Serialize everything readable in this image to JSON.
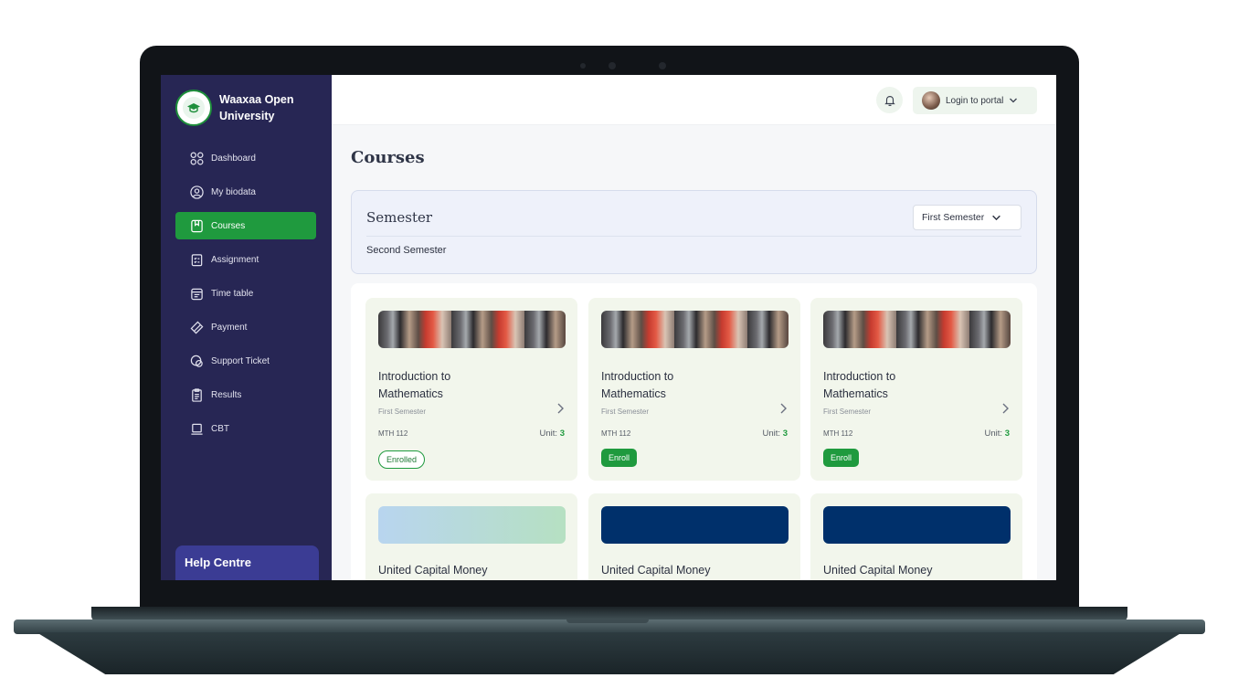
{
  "brand": {
    "name": "Waaxaa Open University",
    "logo_text": "WaaXaa"
  },
  "sidebar": {
    "items": [
      {
        "label": "Dashboard",
        "icon": "grid-icon"
      },
      {
        "label": "My biodata",
        "icon": "user-circle-icon"
      },
      {
        "label": "Courses",
        "icon": "book-icon",
        "active": true
      },
      {
        "label": "Assignment",
        "icon": "clipboard-icon"
      },
      {
        "label": "Time table",
        "icon": "calendar-icon"
      },
      {
        "label": "Payment",
        "icon": "tag-icon"
      },
      {
        "label": "Support Ticket",
        "icon": "chat-icon"
      },
      {
        "label": "Results",
        "icon": "document-icon"
      },
      {
        "label": "CBT",
        "icon": "laptop-icon"
      }
    ],
    "help_title": "Help Centre"
  },
  "topbar": {
    "login_label": "Login to portal"
  },
  "main": {
    "title": "Courses",
    "semester": {
      "title": "Semester",
      "selected": "First Semester",
      "option": "Second Semester"
    },
    "courses": [
      {
        "title": "Introduction to Mathematics",
        "semester": "First Semester",
        "code": "MTH 112",
        "unit_label": "Unit:",
        "unit": "3",
        "action": "Enrolled"
      },
      {
        "title": "Introduction to Mathematics",
        "semester": "First Semester",
        "code": "MTH 112",
        "unit_label": "Unit:",
        "unit": "3",
        "action": "Enroll"
      },
      {
        "title": "Introduction to Mathematics",
        "semester": "First Semester",
        "code": "MTH 112",
        "unit_label": "Unit:",
        "unit": "3",
        "action": "Enroll"
      }
    ],
    "courses_row2": [
      {
        "title": "United Capital Money"
      },
      {
        "title": "United Capital Money"
      },
      {
        "title": "United Capital Money"
      }
    ]
  },
  "colors": {
    "sidebar": "#272654",
    "accent": "#1f9a3e",
    "help": "#3b3c94",
    "navy": "#00306b"
  }
}
